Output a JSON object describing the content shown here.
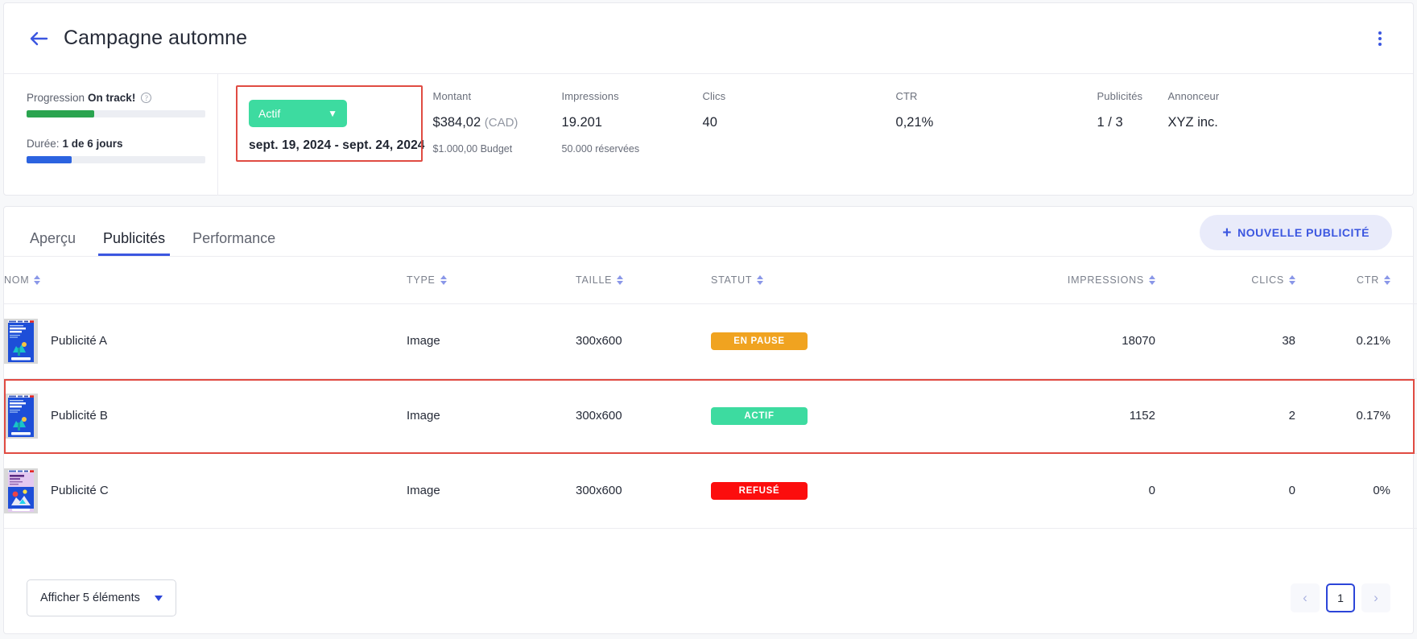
{
  "header": {
    "back_icon": "arrow-left-icon",
    "title": "Campagne automne",
    "menu_icon": "kebab-menu-icon"
  },
  "progress": {
    "label_prefix": "Progression",
    "label_value": "On track!",
    "help_icon": "help-circle-icon",
    "progress_percent": 38,
    "progress_color": "#2aa44f",
    "duration_label": "Durée:",
    "duration_value": "1 de 6 jours",
    "duration_percent": 25,
    "duration_color": "#2c63e0"
  },
  "status": {
    "pill_label": "Actif",
    "pill_color": "#3ddba0",
    "chevron_icon": "chevron-down-icon",
    "date_range": "sept. 19, 2024 - sept. 24, 2024",
    "highlight_color": "#e04b42"
  },
  "metrics": [
    {
      "label": "Montant",
      "value": "$384,02",
      "suffix": "(CAD)",
      "sub": "$1.000,00 Budget"
    },
    {
      "label": "Impressions",
      "value": "19.201",
      "suffix": "",
      "sub": "50.000 réservées"
    },
    {
      "label": "Clics",
      "value": "40",
      "suffix": "",
      "sub": ""
    },
    {
      "label": "CTR",
      "value": "0,21%",
      "suffix": "",
      "sub": ""
    },
    {
      "label": "Publicités",
      "value": "1 / 3",
      "suffix": "",
      "sub": ""
    },
    {
      "label": "Annonceur",
      "value": "XYZ inc.",
      "suffix": "",
      "sub": ""
    }
  ],
  "tabs": [
    {
      "label": "Aperçu",
      "active": false
    },
    {
      "label": "Publicités",
      "active": true
    },
    {
      "label": "Performance",
      "active": false
    }
  ],
  "new_ad_button": {
    "plus": "+",
    "label": "NOUVELLE PUBLICITÉ"
  },
  "table": {
    "columns": [
      {
        "label": "NOM",
        "sort_icon": "sort-arrows-icon"
      },
      {
        "label": "TYPE",
        "sort_icon": "sort-arrows-icon"
      },
      {
        "label": "TAILLE",
        "sort_icon": "sort-arrows-icon"
      },
      {
        "label": "STATUT",
        "sort_icon": "sort-arrows-icon"
      },
      {
        "label": "IMPRESSIONS",
        "sort_icon": "sort-arrows-icon"
      },
      {
        "label": "CLICS",
        "sort_icon": "sort-arrows-icon"
      },
      {
        "label": "CTR",
        "sort_icon": "sort-arrows-icon"
      }
    ],
    "rows": [
      {
        "thumbnail": "ad-creative-thumbnail",
        "name": "Publicité A",
        "type": "Image",
        "size": "300x600",
        "status": "EN PAUSE",
        "status_color": "#f0a320",
        "impressions": "18070",
        "clics": "38",
        "ctr": "0.21%",
        "highlighted": false
      },
      {
        "thumbnail": "ad-creative-thumbnail",
        "name": "Publicité B",
        "type": "Image",
        "size": "300x600",
        "status": "ACTIF",
        "status_color": "#3ddba0",
        "impressions": "1152",
        "clics": "2",
        "ctr": "0.17%",
        "highlighted": true
      },
      {
        "thumbnail": "ad-creative-thumbnail",
        "name": "Publicité C",
        "type": "Image",
        "size": "300x600",
        "status": "REFUSÉ",
        "status_color": "#fc0d0d",
        "impressions": "0",
        "clics": "0",
        "ctr": "0%",
        "highlighted": false
      }
    ]
  },
  "footer": {
    "page_size_label": "Afficher 5 éléments",
    "caret_icon": "caret-down-icon",
    "prev_icon": "chevron-left-icon",
    "current_page": "1",
    "next_icon": "chevron-right-icon"
  }
}
